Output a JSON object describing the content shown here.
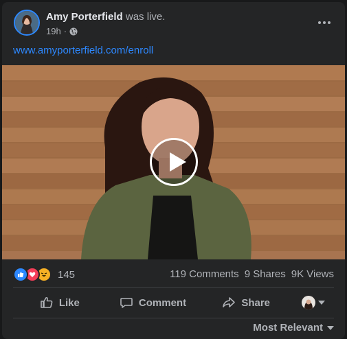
{
  "post": {
    "author_name": "Amy Porterfield",
    "author_suffix": " was live.",
    "timestamp": "19h",
    "separator": " · ",
    "audience_icon": "globe-icon",
    "more_icon": "more-options-icon",
    "link_text": "www.amyporterfield.com/enroll",
    "video_icon": "play-icon"
  },
  "stats": {
    "reaction_icons": [
      "like-icon",
      "love-icon",
      "haha-icon"
    ],
    "reaction_count": "145",
    "comments": "119 Comments",
    "shares": "9 Shares",
    "views": "9K Views"
  },
  "actions": {
    "like_label": "Like",
    "comment_label": "Comment",
    "share_label": "Share"
  },
  "sort": {
    "label": "Most Relevant"
  },
  "colors": {
    "background": "#18191a",
    "card": "#242526",
    "link": "#2d88ff",
    "primary_text": "#e4e6eb",
    "secondary_text": "#b0b3b8",
    "like": "#2d88ff",
    "love": "#f33e58",
    "haha": "#f7b125"
  }
}
